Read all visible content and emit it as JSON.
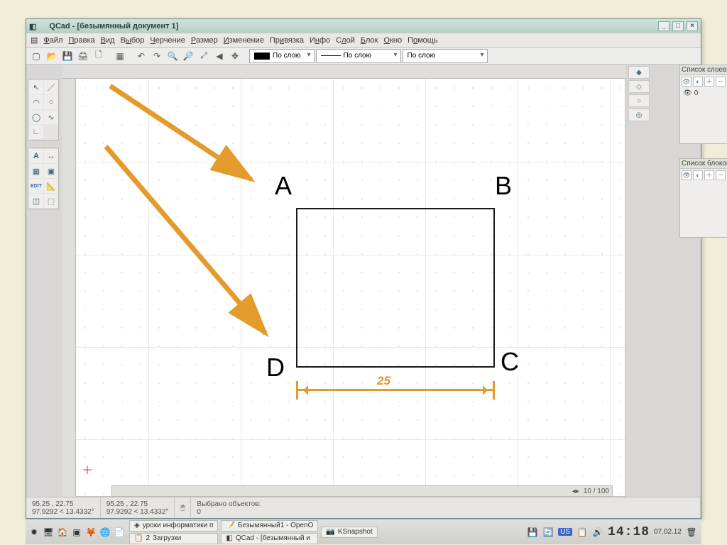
{
  "window": {
    "title": "QCad - [безымянный документ 1]"
  },
  "menu": {
    "file": "Файл",
    "edit": "Правка",
    "view": "Вид",
    "select": "Выбор",
    "draw": "Черчение",
    "size": "Размер",
    "modify": "Изменение",
    "snap": "Привязка",
    "info": "Инфо",
    "layer": "Слой",
    "block": "Блок",
    "window": "Окно",
    "help": "Помощь"
  },
  "toolbar": {
    "combo_layer_label": "По слою",
    "combo_line_label": "По слою",
    "combo_weight_label": "По слою"
  },
  "panels": {
    "layers_title": "Список слоев",
    "blocks_title": "Список блоков",
    "layer0": "0"
  },
  "scroll": {
    "info": "10 / 100"
  },
  "status": {
    "coord1a": "95.25 , 22.75",
    "coord1b": "97.9292 < 13.4332°",
    "coord2a": "95.25 , 22.75",
    "coord2b": "97.9292 < 13.4332°",
    "sel_label": "Выбрано объектов:",
    "sel_count": "0"
  },
  "canvas": {
    "labelA": "A",
    "labelB": "B",
    "labelC": "C",
    "labelD": "D",
    "dim_value": "25"
  },
  "taskbar": {
    "item_lessons": "уроки информатики п",
    "item_doc": "Безымянный1 - OpenO",
    "item_snap": "KSnapshot",
    "item_count": "2",
    "item_downloads": "Загрузки",
    "item_qcad": "QCad - [безымянный и",
    "lang": "US",
    "time": "14:18",
    "date": "07.02.12"
  }
}
